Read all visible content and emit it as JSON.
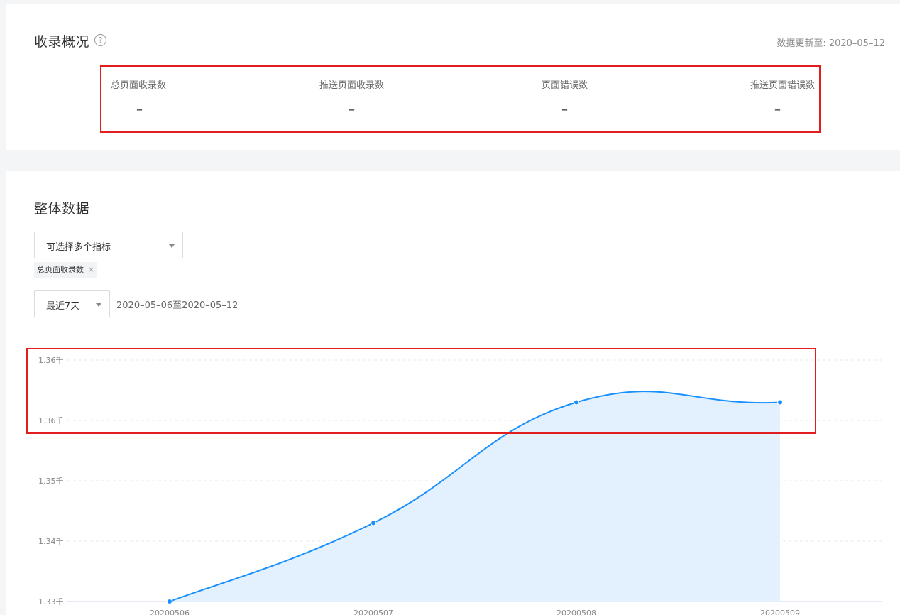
{
  "overview": {
    "title": "收录概况",
    "help_icon": "question-circle-icon",
    "update_time": "数据更新至: 2020–05–12",
    "stats": [
      {
        "label": "总页面收录数",
        "value": "–"
      },
      {
        "label": "推送页面收录数",
        "value": "–"
      },
      {
        "label": "页面错误数",
        "value": "–"
      },
      {
        "label": "推送页面错误数",
        "value": "–"
      }
    ]
  },
  "overall": {
    "title": "整体数据",
    "metric_select": {
      "placeholder": "可选择多个指标"
    },
    "selected_tag": {
      "label": "总页面收录数",
      "close": "×"
    },
    "period_select": {
      "value": "最近7天"
    },
    "date_range": "2020–05–06至2020–05–12"
  },
  "colors": {
    "line": "#1890ff",
    "area": "#e3f0fd",
    "highlight": "#e01e1e"
  },
  "chart_data": {
    "type": "area",
    "x": [
      "20200506",
      "20200507",
      "20200508",
      "20200509"
    ],
    "series": [
      {
        "values": [
          1330,
          1343,
          1363,
          1363
        ]
      }
    ],
    "y_ticks": [
      "1.33千",
      "1.34千",
      "1.35千",
      "1.36千",
      "1.36千"
    ],
    "ylim": [
      1330,
      1370
    ],
    "grid": true
  }
}
